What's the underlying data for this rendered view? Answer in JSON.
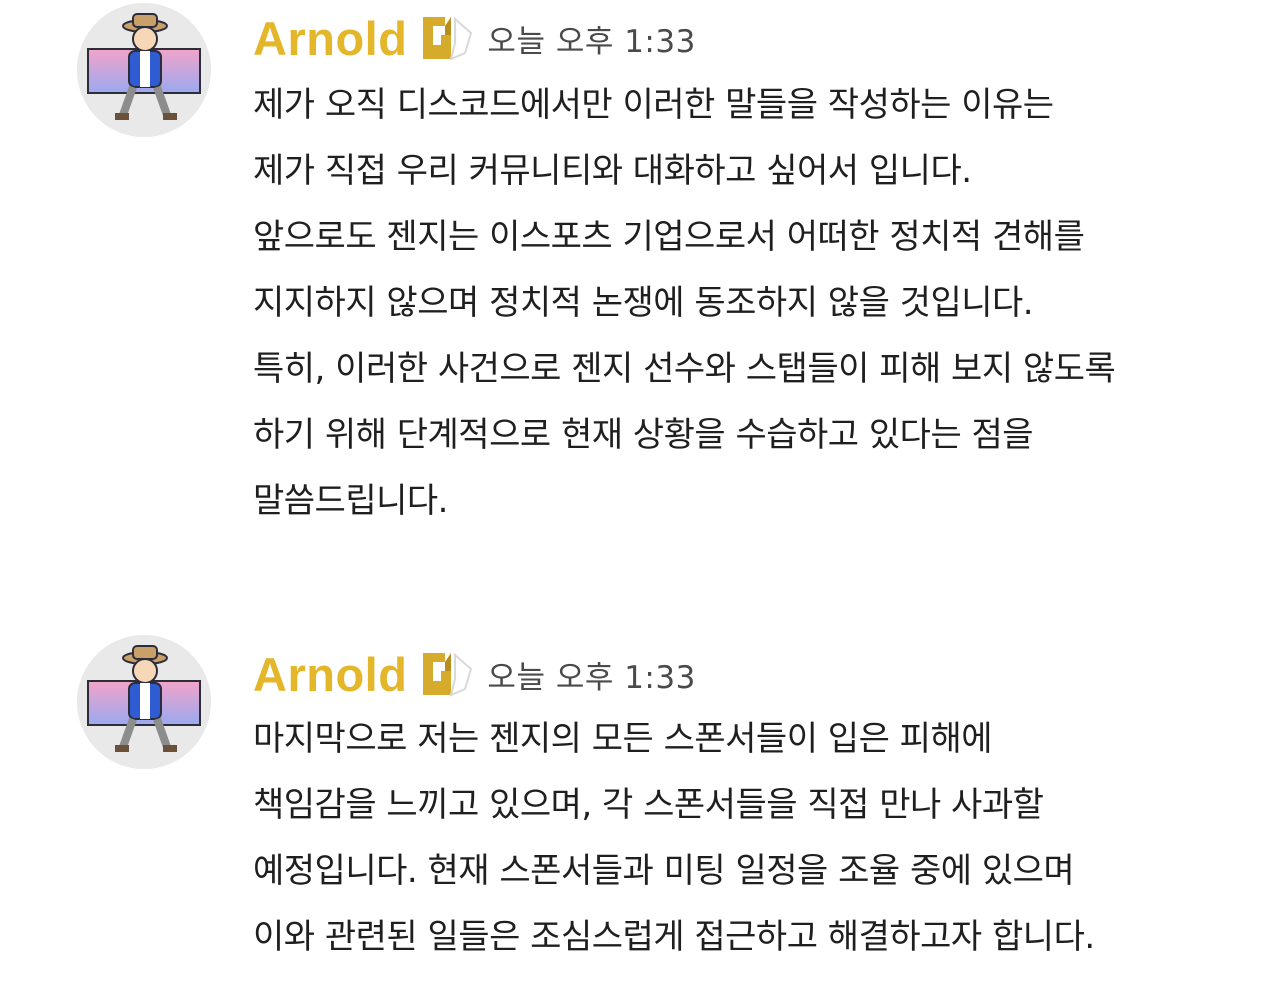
{
  "colors": {
    "username": "#e4b62a",
    "text": "#1f1f1f",
    "timestamp": "#4a4a4a",
    "avatar_bg": "#e9e9e9"
  },
  "messages": [
    {
      "author": "Arnold",
      "badge_icon": "gen-g-logo-icon",
      "timestamp": "오늘 오후 1:33",
      "lines": [
        "제가 오직 디스코드에서만 이러한 말들을 작성하는 이유는",
        "제가 직접 우리 커뮤니티와 대화하고 싶어서 입니다.",
        "앞으로도 젠지는 이스포츠 기업으로서 어떠한 정치적 견해를",
        "지지하지 않으며 정치적 논쟁에 동조하지 않을 것입니다.",
        "특히, 이러한 사건으로 젠지 선수와 스탭들이 피해 보지 않도록",
        "하기 위해 단계적으로 현재 상황을 수습하고 있다는 점을",
        "말씀드립니다."
      ]
    },
    {
      "author": "Arnold",
      "badge_icon": "gen-g-logo-icon",
      "timestamp": "오늘 오후 1:33",
      "lines": [
        "마지막으로 저는 젠지의 모든 스폰서들이 입은 피해에",
        "책임감을 느끼고 있으며, 각 스폰서들을 직접 만나 사과할",
        "예정입니다. 현재 스폰서들과 미팅 일정을 조율 중에 있으며",
        "이와 관련된 일들은 조심스럽게 접근하고 해결하고자 합니다."
      ]
    }
  ]
}
